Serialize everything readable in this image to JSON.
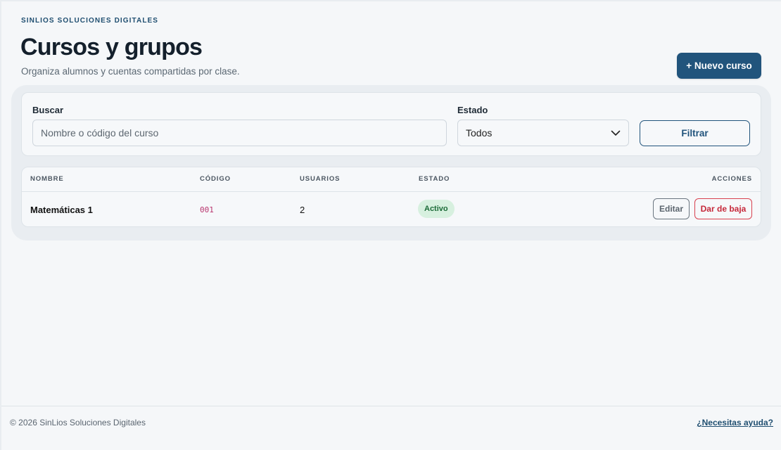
{
  "brand": "SINLIOS SOLUCIONES DIGITALES",
  "header": {
    "title": "Cursos y grupos",
    "subtitle": "Organiza alumnos y cuentas compartidas por clase.",
    "new_course_label": "+ Nuevo curso"
  },
  "filters": {
    "search_label": "Buscar",
    "search_placeholder": "Nombre o código del curso",
    "search_value": "",
    "status_label": "Estado",
    "status_value": "Todos",
    "filter_button": "Filtrar"
  },
  "table": {
    "columns": [
      "NOMBRE",
      "CÓDIGO",
      "USUARIOS",
      "ESTADO",
      "ACCIONES"
    ],
    "rows": [
      {
        "name": "Matemáticas 1",
        "code": "001",
        "users": "2",
        "status": "Activo",
        "actions": [
          "Editar",
          "Dar de baja"
        ]
      }
    ]
  },
  "footer": {
    "copyright": "© 2026 SinLios Soluciones Digitales",
    "help_link": "¿Necesitas ayuda?"
  },
  "colors": {
    "primary": "#21547c",
    "danger": "#c6283a",
    "success_bg": "#d7f0df",
    "success_text": "#1c6b38",
    "code_text": "#b8356e"
  }
}
